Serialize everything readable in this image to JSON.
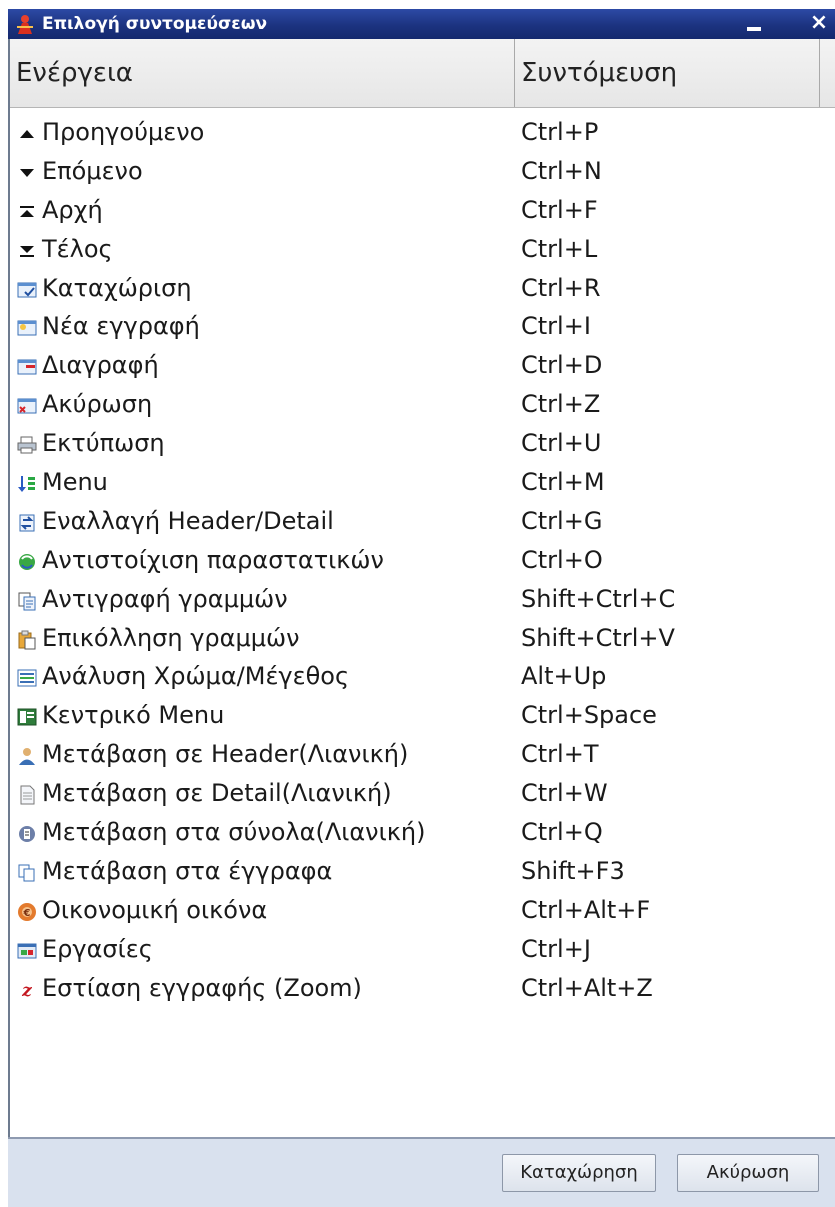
{
  "window": {
    "title": "Επιλογή συντομεύσεων",
    "minimize_label": "",
    "close_label": "×"
  },
  "grid": {
    "headers": {
      "action": "Ενέργεια",
      "shortcut": "Συντόμευση"
    },
    "rows": [
      {
        "icon": "arrow-up-icon",
        "label": "Προηγούμενο",
        "shortcut": "Ctrl+P"
      },
      {
        "icon": "arrow-down-icon",
        "label": "Επόμενο",
        "shortcut": "Ctrl+N"
      },
      {
        "icon": "first-record-icon",
        "label": "Αρχή",
        "shortcut": "Ctrl+F"
      },
      {
        "icon": "last-record-icon",
        "label": "Τέλος",
        "shortcut": "Ctrl+L"
      },
      {
        "icon": "save-record-icon",
        "label": "Καταχώριση",
        "shortcut": "Ctrl+R"
      },
      {
        "icon": "new-record-icon",
        "label": "Νέα εγγραφή",
        "shortcut": "Ctrl+I"
      },
      {
        "icon": "delete-record-icon",
        "label": "Διαγραφή",
        "shortcut": "Ctrl+D"
      },
      {
        "icon": "cancel-record-icon",
        "label": "Ακύρωση",
        "shortcut": "Ctrl+Z"
      },
      {
        "icon": "printer-icon",
        "label": "Εκτύπωση",
        "shortcut": "Ctrl+U"
      },
      {
        "icon": "menu-icon",
        "label": "Menu",
        "shortcut": "Ctrl+M"
      },
      {
        "icon": "swap-header-detail-icon",
        "label": "Εναλλαγή Header/Detail",
        "shortcut": "Ctrl+G"
      },
      {
        "icon": "match-documents-icon",
        "label": "Αντιστοίχιση παραστατικών",
        "shortcut": "Ctrl+O"
      },
      {
        "icon": "copy-lines-icon",
        "label": "Αντιγραφή γραμμών",
        "shortcut": "Shift+Ctrl+C"
      },
      {
        "icon": "paste-lines-icon",
        "label": "Επικόλληση γραμμών",
        "shortcut": "Shift+Ctrl+V"
      },
      {
        "icon": "color-size-icon",
        "label": "Ανάλυση Χρώμα/Μέγεθος",
        "shortcut": "Alt+Up"
      },
      {
        "icon": "main-menu-icon",
        "label": "Κεντρικό Menu",
        "shortcut": "Ctrl+Space"
      },
      {
        "icon": "user-icon",
        "label": "Μετάβαση σε Header(Λιανική)",
        "shortcut": "Ctrl+T"
      },
      {
        "icon": "document-icon",
        "label": "Μετάβαση σε Detail(Λιανική)",
        "shortcut": "Ctrl+W"
      },
      {
        "icon": "totals-icon",
        "label": "Μετάβαση στα σύνολα(Λιανική)",
        "shortcut": "Ctrl+Q"
      },
      {
        "icon": "documents-icon",
        "label": "Μετάβαση στα έγγραφα",
        "shortcut": "Shift+F3"
      },
      {
        "icon": "finance-icon",
        "label": "Οικονομική οικόνα",
        "shortcut": "Ctrl+Alt+F"
      },
      {
        "icon": "tasks-icon",
        "label": "Εργασίες",
        "shortcut": "Ctrl+J"
      },
      {
        "icon": "zoom-icon",
        "label": "Εστίαση εγγραφής (Zoom)",
        "shortcut": "Ctrl+Alt+Z"
      }
    ]
  },
  "footer": {
    "save_label": "Καταχώρηση",
    "cancel_label": "Ακύρωση"
  },
  "colors": {
    "titlebar": "#1c3380",
    "footer": "#d9e1ee",
    "grid_border": "#6d7b8f"
  }
}
